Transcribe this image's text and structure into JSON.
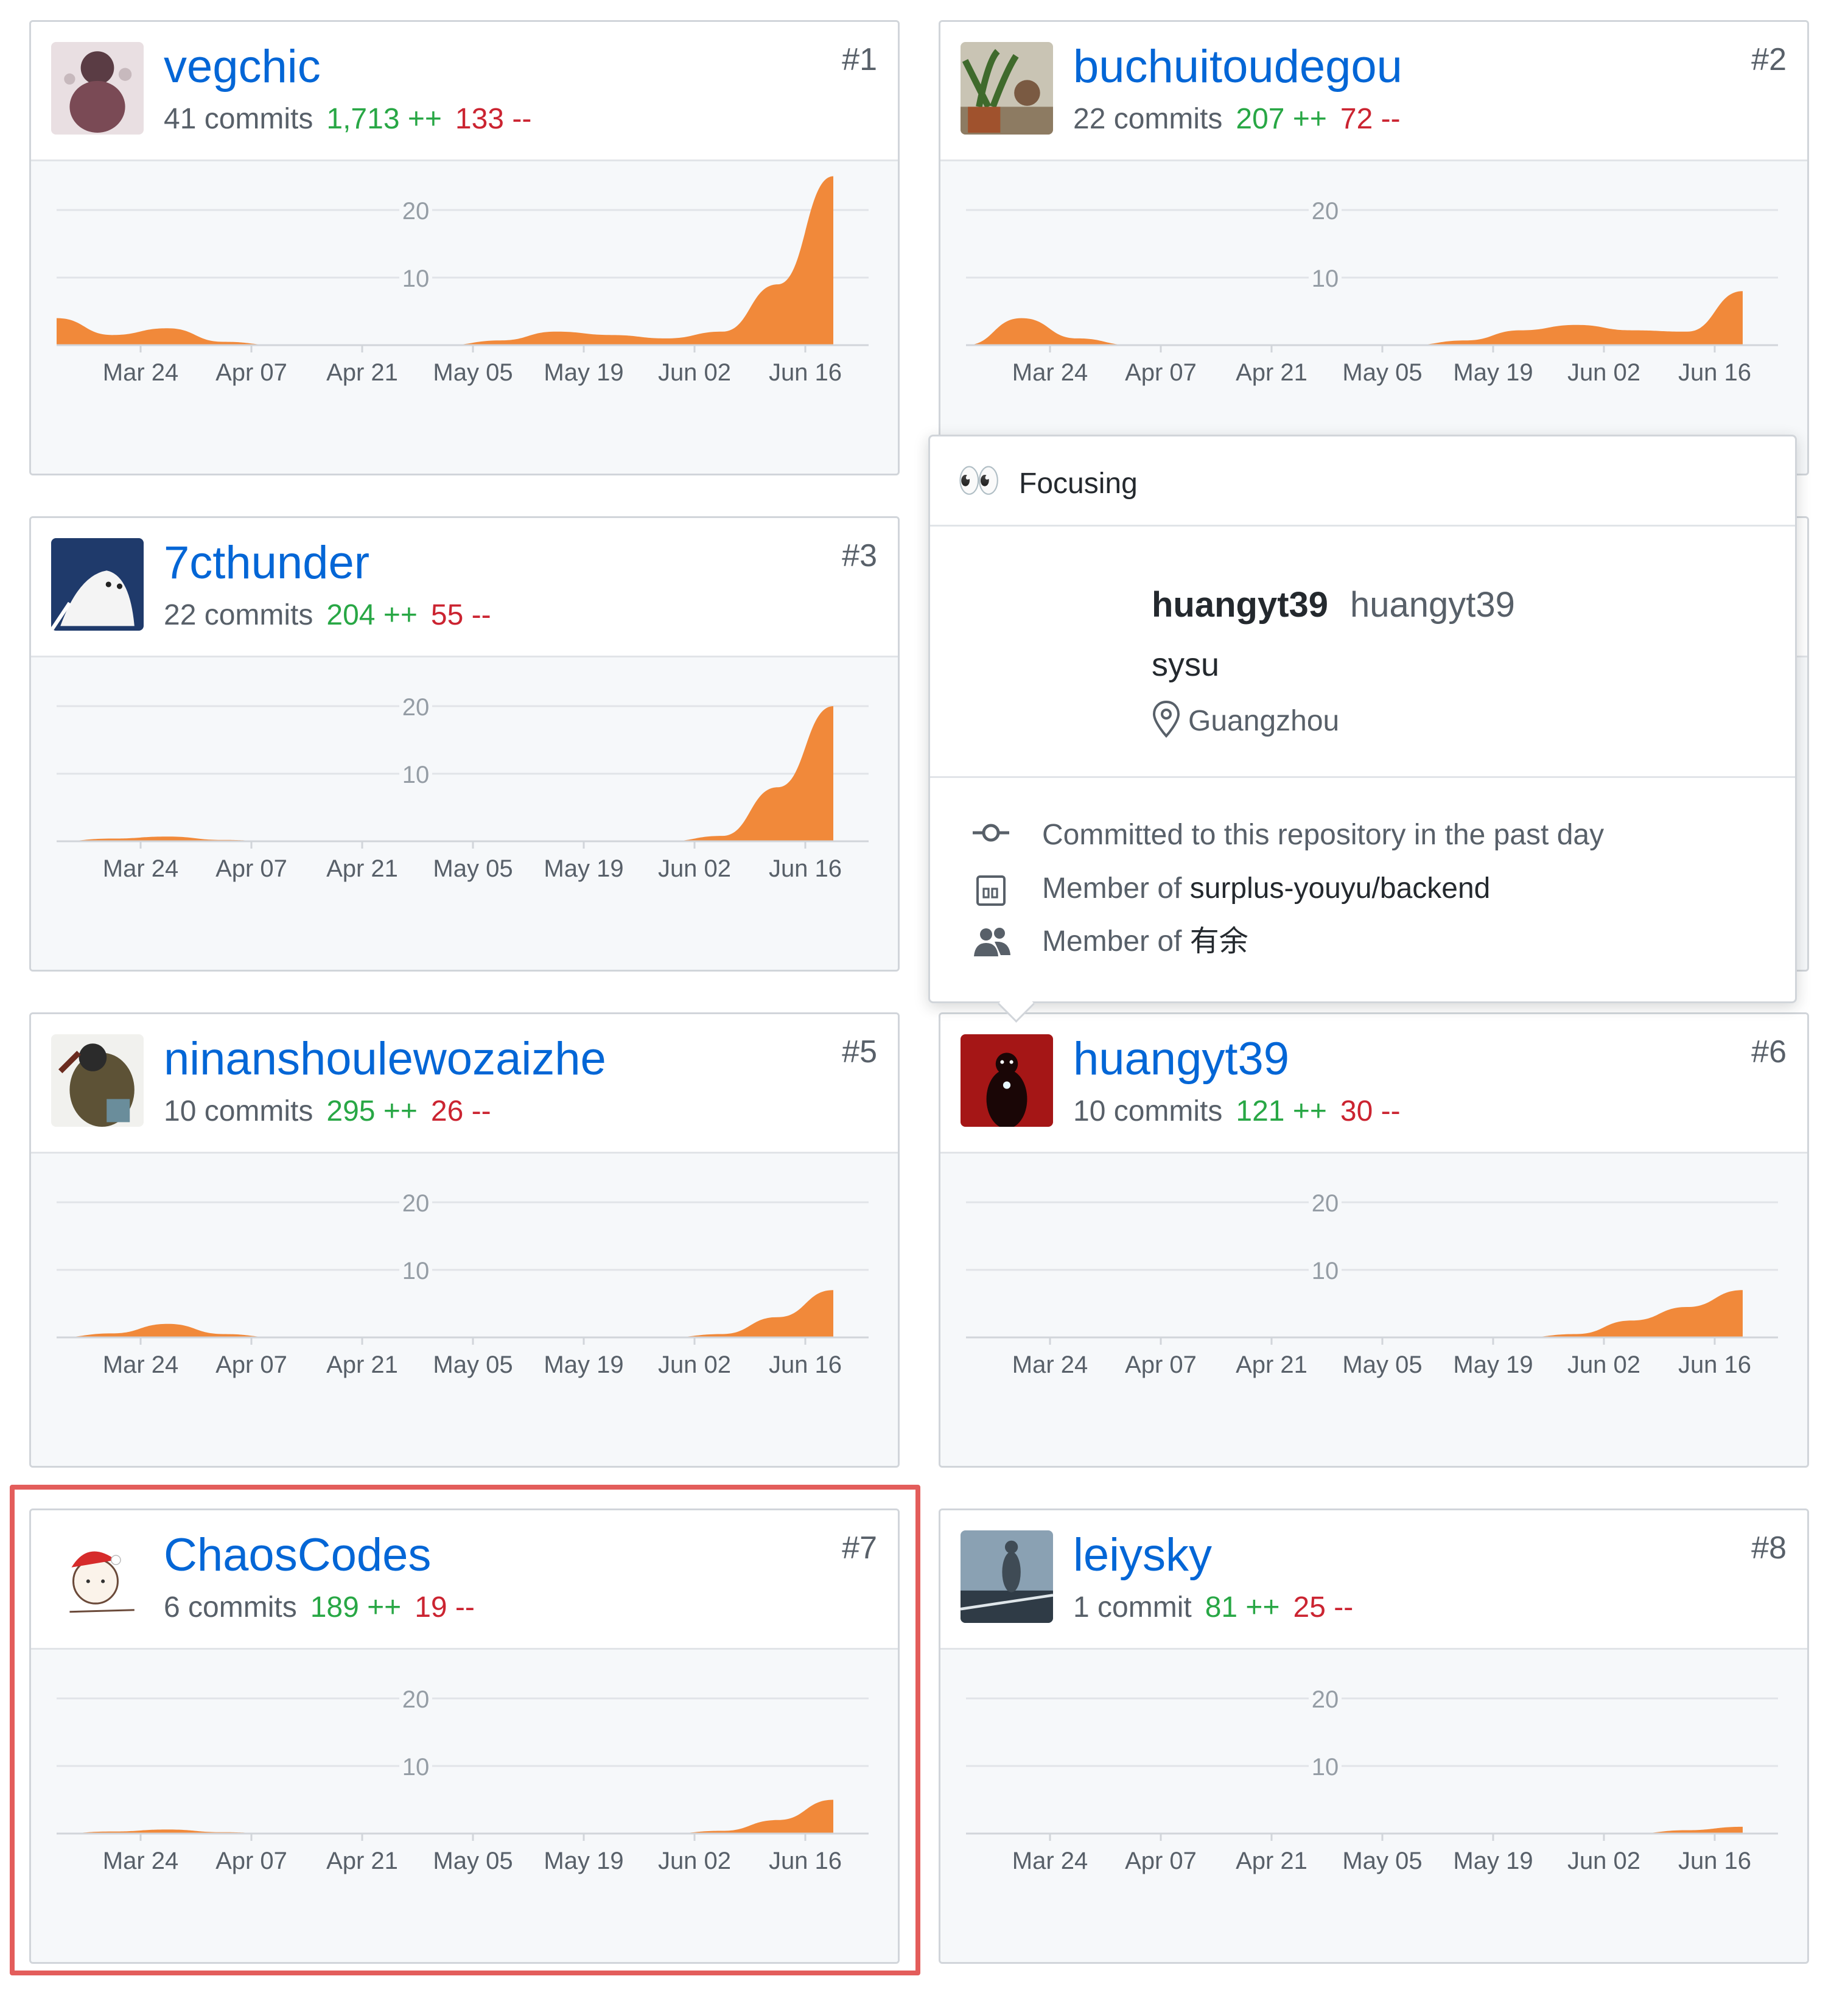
{
  "axis": {
    "y_ticks": [
      "20",
      "10"
    ],
    "x_ticks": [
      "Mar 24",
      "Apr 07",
      "Apr 21",
      "May 05",
      "May 19",
      "Jun 02",
      "Jun 16"
    ]
  },
  "fill_color": "#f1893a",
  "contributors": [
    {
      "username": "vegchic",
      "commits": "41 commits",
      "additions": "1,713 ++",
      "deletions": "133 --",
      "rank": "#1",
      "avatar": "avatar-vegchic"
    },
    {
      "username": "buchuitoudegou",
      "commits": "22 commits",
      "additions": "207 ++",
      "deletions": "72 --",
      "rank": "#2",
      "avatar": "avatar-buchuitoudegou"
    },
    {
      "username": "7cthunder",
      "commits": "22 commits",
      "additions": "204 ++",
      "deletions": "55 --",
      "rank": "#3",
      "avatar": "avatar-7cthunder"
    },
    {
      "username": "ninanshoulewozaizhe",
      "commits": "10 commits",
      "additions": "295 ++",
      "deletions": "26 --",
      "rank": "#5",
      "avatar": "avatar-ninanshoulewozaizhe"
    },
    {
      "username": "huangyt39",
      "commits": "10 commits",
      "additions": "121 ++",
      "deletions": "30 --",
      "rank": "#6",
      "avatar": "avatar-huangyt39"
    },
    {
      "username": "ChaosCodes",
      "commits": "6 commits",
      "additions": "189 ++",
      "deletions": "19 --",
      "rank": "#7",
      "avatar": "avatar-chaoscodes"
    },
    {
      "username": "leiysky",
      "commits": "1 commit",
      "additions": "81 ++",
      "deletions": "25 --",
      "rank": "#8",
      "avatar": "avatar-leiysky"
    }
  ],
  "hovercard": {
    "status_emoji": "👀",
    "status": "Focusing",
    "login": "huangyt39",
    "name": "huangyt39",
    "bio": "sysu",
    "location": "Guangzhou",
    "activity": "Committed to this repository in the past day",
    "member_prefix": "Member of ",
    "repo": "surplus-youyu/backend",
    "org": "有余"
  },
  "chart_data": [
    {
      "type": "area",
      "title": "vegchic",
      "x": [
        "Mar 17",
        "Mar 24",
        "Mar 31",
        "Apr 07",
        "Apr 14",
        "Apr 21",
        "Apr 28",
        "May 05",
        "May 12",
        "May 19",
        "May 26",
        "Jun 02",
        "Jun 09",
        "Jun 16",
        "Jun 23"
      ],
      "y": [
        4,
        1.5,
        2.5,
        0.5,
        0,
        0,
        0,
        0,
        0.7,
        2,
        1.5,
        1,
        2,
        9,
        25
      ],
      "ylim": [
        0,
        25
      ]
    },
    {
      "type": "area",
      "title": "buchuitoudegou",
      "x": [
        "Mar 17",
        "Mar 24",
        "Mar 31",
        "Apr 07",
        "Apr 14",
        "Apr 21",
        "Apr 28",
        "May 05",
        "May 12",
        "May 19",
        "May 26",
        "Jun 02",
        "Jun 09",
        "Jun 16",
        "Jun 23"
      ],
      "y": [
        0,
        4,
        1,
        0,
        0,
        0,
        0,
        0,
        0,
        0.7,
        2.2,
        3,
        2.2,
        2,
        8
      ],
      "ylim": [
        0,
        25
      ]
    },
    {
      "type": "area",
      "title": "7cthunder",
      "x": [
        "Mar 17",
        "Mar 24",
        "Mar 31",
        "Apr 07",
        "Apr 14",
        "Apr 21",
        "Apr 28",
        "May 05",
        "May 12",
        "May 19",
        "May 26",
        "Jun 02",
        "Jun 09",
        "Jun 16",
        "Jun 23"
      ],
      "y": [
        0,
        0.4,
        0.7,
        0.2,
        0,
        0,
        0,
        0,
        0,
        0,
        0,
        0,
        0.8,
        8,
        20
      ],
      "ylim": [
        0,
        25
      ]
    },
    {
      "type": "area",
      "title": "ninanshoulewozaizhe",
      "x": [
        "Mar 17",
        "Mar 24",
        "Mar 31",
        "Apr 07",
        "Apr 14",
        "Apr 21",
        "Apr 28",
        "May 05",
        "May 12",
        "May 19",
        "May 26",
        "Jun 02",
        "Jun 09",
        "Jun 16",
        "Jun 23"
      ],
      "y": [
        0,
        0.6,
        2,
        0.5,
        0,
        0,
        0,
        0,
        0,
        0,
        0,
        0,
        0.5,
        3,
        7
      ],
      "ylim": [
        0,
        25
      ]
    },
    {
      "type": "area",
      "title": "huangyt39",
      "x": [
        "Mar 17",
        "Mar 24",
        "Mar 31",
        "Apr 07",
        "Apr 14",
        "Apr 21",
        "Apr 28",
        "May 05",
        "May 12",
        "May 19",
        "May 26",
        "Jun 02",
        "Jun 09",
        "Jun 16",
        "Jun 23"
      ],
      "y": [
        0,
        0,
        0,
        0,
        0,
        0,
        0,
        0,
        0,
        0,
        0,
        0.5,
        2.5,
        4.5,
        7
      ],
      "ylim": [
        0,
        25
      ]
    },
    {
      "type": "area",
      "title": "ChaosCodes",
      "x": [
        "Mar 17",
        "Mar 24",
        "Mar 31",
        "Apr 07",
        "Apr 14",
        "Apr 21",
        "Apr 28",
        "May 05",
        "May 12",
        "May 19",
        "May 26",
        "Jun 02",
        "Jun 09",
        "Jun 16",
        "Jun 23"
      ],
      "y": [
        0,
        0.3,
        0.6,
        0.2,
        0,
        0,
        0,
        0,
        0,
        0,
        0,
        0,
        0.4,
        2,
        5
      ],
      "ylim": [
        0,
        25
      ]
    },
    {
      "type": "area",
      "title": "leiysky",
      "x": [
        "Mar 17",
        "Mar 24",
        "Mar 31",
        "Apr 07",
        "Apr 14",
        "Apr 21",
        "Apr 28",
        "May 05",
        "May 12",
        "May 19",
        "May 26",
        "Jun 02",
        "Jun 09",
        "Jun 16",
        "Jun 23"
      ],
      "y": [
        0,
        0,
        0,
        0,
        0,
        0,
        0,
        0,
        0,
        0,
        0,
        0,
        0,
        0.5,
        1
      ],
      "ylim": [
        0,
        25
      ]
    }
  ]
}
